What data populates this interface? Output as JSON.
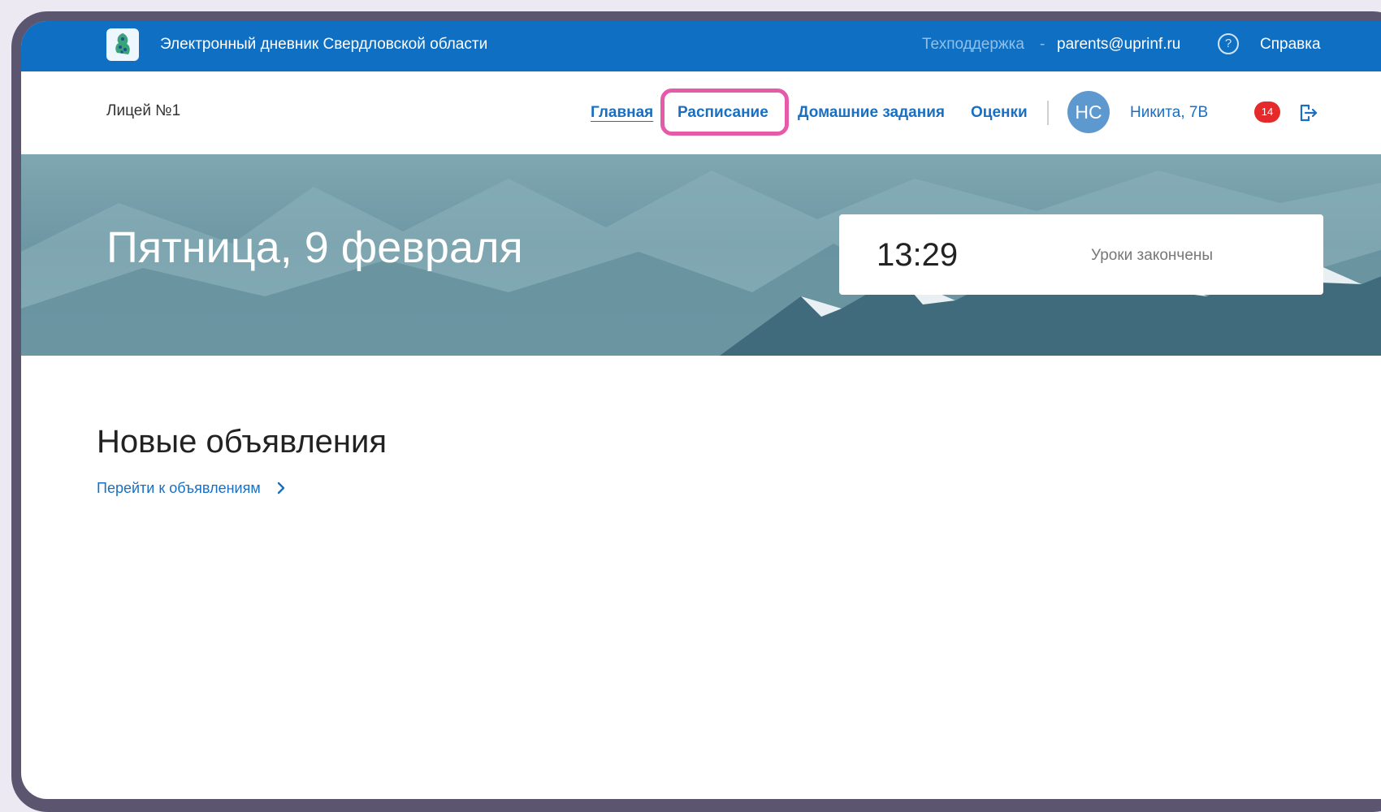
{
  "header": {
    "title": "Электронный дневник Свердловской области",
    "support_label": "Техподдержка",
    "support_separator": "-",
    "support_email": "parents@uprinf.ru",
    "help_icon_glyph": "?",
    "help_label": "Справка"
  },
  "navbar": {
    "school": "Лицей №1",
    "links": [
      {
        "label": "Главная"
      },
      {
        "label": "Расписание"
      },
      {
        "label": "Домашние задания"
      },
      {
        "label": "Оценки"
      }
    ],
    "active_link": "Главная",
    "highlighted_link": "Расписание",
    "user": {
      "initials": "НС",
      "name": "Никита, 7В"
    },
    "notifications_count": "14"
  },
  "hero": {
    "date": "Пятница, 9 февраля",
    "time": "13:29",
    "status": "Уроки закончены"
  },
  "announcements": {
    "title": "Новые объявления",
    "link_label": "Перейти к объявлениям"
  },
  "colors": {
    "topbar": "#0f6fc3",
    "link": "#1a6fc0",
    "highlight": "#e65aaa",
    "badge": "#e42a2a",
    "avatar": "#5d99cf"
  },
  "icons": [
    "app-logo-icon",
    "help-circle-icon",
    "logout-icon",
    "chevron-right-icon"
  ]
}
